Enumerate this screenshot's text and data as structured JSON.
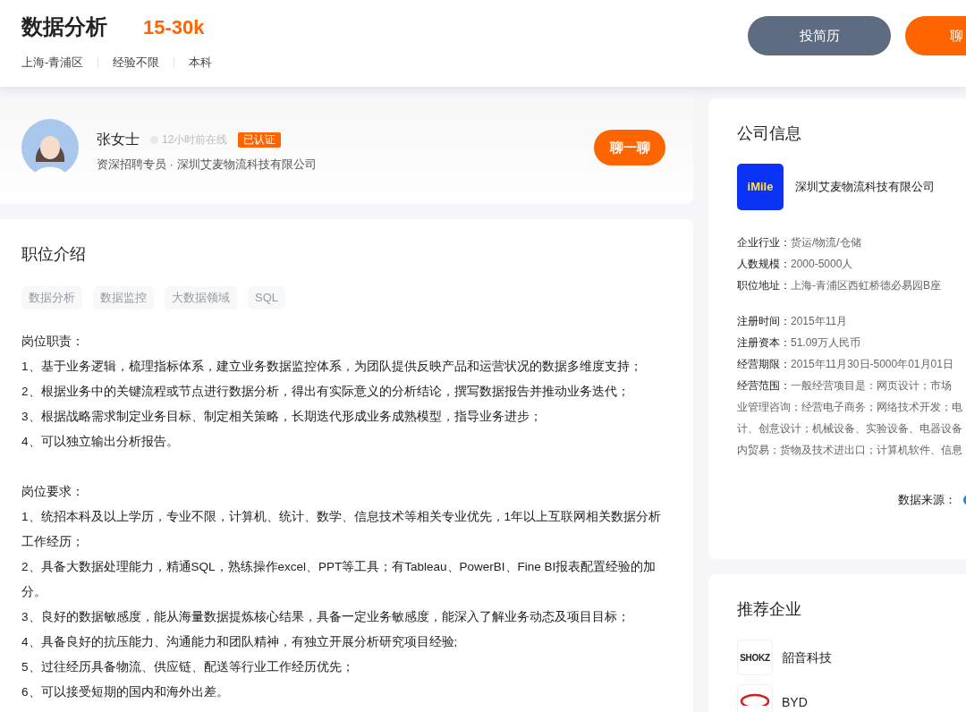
{
  "job": {
    "title": "数据分析",
    "salary": "15-30k",
    "tags": [
      "上海-青浦区",
      "经验不限",
      "本科"
    ],
    "buttons": [
      {
        "label": "投简历",
        "kind": "secondary"
      },
      {
        "label": "聊",
        "kind": "primary"
      }
    ]
  },
  "recruiter": {
    "name": "张女士",
    "online": "12小时前在线",
    "verified": "已认证",
    "role": "资深招聘专员 · 深圳艾麦物流科技有限公司",
    "chat": "聊一聊"
  },
  "description": {
    "heading": "职位介绍",
    "keywords": [
      "数据分析",
      "数据监控",
      "大数据领域",
      "SQL"
    ],
    "sections": [
      {
        "heading": "岗位职责：",
        "lines": [
          "1、基于业务逻辑，梳理指标体系，建立业务数据监控体系，为团队提供反映产品和运营状况的数据多维度支持；",
          "2、根据业务中的关键流程或节点进行数据分析，得出有实际意义的分析结论，撰写数据报告并推动业务迭代；",
          "3、根据战略需求制定业务目标、制定相关策略，长期迭代形成业务成熟模型，指导业务进步；",
          "4、可以独立输出分析报告。"
        ]
      },
      {
        "heading": "岗位要求：",
        "lines": [
          "1、统招本科及以上学历，专业不限，计算机、统计、数学、信息技术等相关专业优先，1年以上互联网相关数据分析工作经历；",
          "2、具备大数据处理能力，精通SQL，熟练操作excel、PPT等工具；有Tableau、PowerBI、Fine BI报表配置经验的加分。",
          "3、良好的数据敏感度，能从海量数据提炼核心结果，具备一定业务敏感度，能深入了解业务动态及项目目标；",
          "4、具备良好的抗压能力、沟通能力和团队精神，有独立开展分析研究项目经验;",
          "5、过往经历具备物流、供应链、配送等行业工作经历优先；",
          "6、可以接受短期的国内和海外出差。"
        ]
      }
    ]
  },
  "company": {
    "heading": "公司信息",
    "logo_text": "iMile",
    "name": "深圳艾麦物流科技有限公司",
    "facts": [
      {
        "label": "企业行业：",
        "value": "货运/物流/仓储"
      },
      {
        "label": "人数规模：",
        "value": "2000-5000人"
      },
      {
        "label": "职位地址：",
        "value": "上海-青浦区西虹桥德必易园B座"
      }
    ],
    "registry": [
      {
        "label": "注册时间：",
        "value": "2015年11月"
      },
      {
        "label": "注册资本：",
        "value": "51.09万人民币"
      },
      {
        "label": "经营期限：",
        "value": "2015年11月30日-5000年01月01日"
      }
    ],
    "scope_label": "经营范围：",
    "scope_lines": [
      "一般经营项目是：网页设计；市场",
      "业管理咨询；经营电子商务；网络技术开发；电",
      "计、创意设计；机械设备、实验设备、电器设备",
      "内贸易；货物及技术进出口；计算机软件、信息"
    ],
    "source": "数据来源："
  },
  "recommended": {
    "heading": "推荐企业",
    "items": [
      {
        "name": "韶音科技",
        "logo_text": "SHOKZ",
        "kind": "text"
      },
      {
        "name": "BYD",
        "kind": "oval"
      }
    ]
  }
}
